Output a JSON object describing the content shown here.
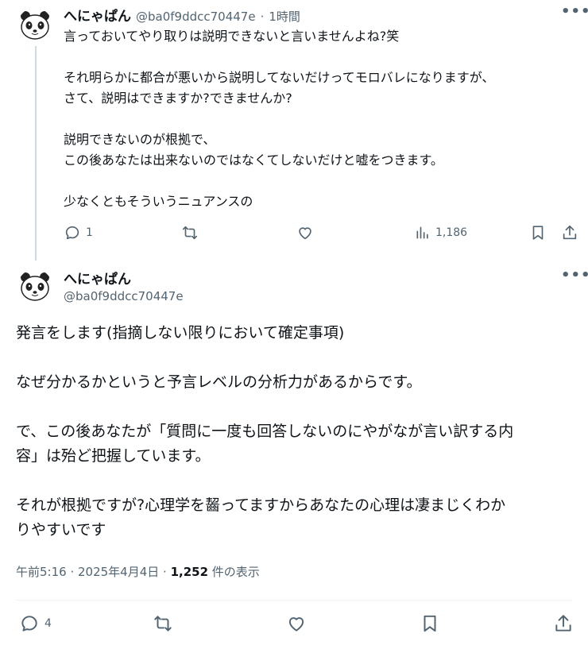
{
  "reply_tweet": {
    "author_name": "へにゃぱん",
    "handle": "@ba0f9ddcc70447e",
    "separator": "·",
    "time": "1時間",
    "text": "言っておいてやり取りは説明できないと言いませんよね?笑\n\nそれ明らかに都合が悪いから説明してないだけってモロバレになりますが、\nさて、説明はできますか?できませんか?\n\n説明できないのが根拠で、\nこの後あなたは出来ないのではなくてしないだけと嘘をつきます。\n\n少なくともそういうニュアンスの",
    "reply_count": "1",
    "views": "1,186"
  },
  "main_tweet": {
    "author_name": "へにゃぱん",
    "handle": "@ba0f9ddcc70447e",
    "text": "発言をします(指摘しない限りにおいて確定事項)\n\nなぜ分かるかというと予言レベルの分析力があるからです。\n\nで、この後あなたが「質問に一度も回答しないのにやがなが言い訳する内\n容」は殆ど把握しています。\n\nそれが根拠ですが?心理学を齧ってますからあなたの心理は凄まじくわか\nりやすいです",
    "timestamp": "午前5:16 · 2025年4月4日 · ",
    "view_count": "1,252",
    "view_suffix": " 件の表示",
    "reply_count": "4"
  },
  "icons": {
    "more": "more-horizontal-icon",
    "reply": "reply-icon",
    "retweet": "retweet-icon",
    "like": "like-icon",
    "views": "views-icon",
    "bookmark": "bookmark-icon",
    "share": "share-icon",
    "avatar": "panda-avatar"
  },
  "colors": {
    "text": "#0f1419",
    "secondary": "#536471",
    "thread_line": "#cfd9de"
  }
}
